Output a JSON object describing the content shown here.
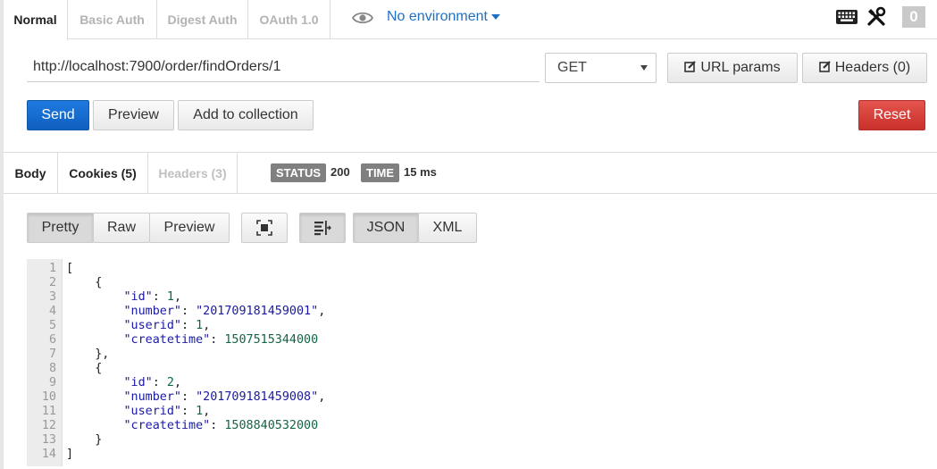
{
  "auth_tabs": [
    "Normal",
    "Basic Auth",
    "Digest Auth",
    "OAuth 1.0"
  ],
  "environment": {
    "label": "No environment"
  },
  "header_count": "0",
  "request": {
    "url": "http://localhost:7900/order/findOrders/1",
    "method": "GET",
    "url_params_label": "URL params",
    "headers_label": "Headers (0)",
    "send_label": "Send",
    "preview_label": "Preview",
    "add_collection_label": "Add to collection",
    "reset_label": "Reset"
  },
  "response": {
    "tabs": [
      "Body",
      "Cookies (5)",
      "Headers (3)"
    ],
    "status_label": "STATUS",
    "status_value": "200",
    "time_label": "TIME",
    "time_value": "15 ms",
    "view_modes": [
      "Pretty",
      "Raw",
      "Preview"
    ],
    "formats": [
      "JSON",
      "XML"
    ],
    "body_lines": [
      "[",
      "    {",
      "        \"id\": 1,",
      "        \"number\": \"201709181459001\",",
      "        \"userid\": 1,",
      "        \"createtime\": 1507515344000",
      "    },",
      "    {",
      "        \"id\": 2,",
      "        \"number\": \"201709181459008\",",
      "        \"userid\": 1,",
      "        \"createtime\": 1508840532000",
      "    }",
      "]"
    ]
  },
  "colors": {
    "accent": "#1f6fc5",
    "send": "#1f7ae0",
    "reset": "#d9443f",
    "pill": "#808080"
  }
}
